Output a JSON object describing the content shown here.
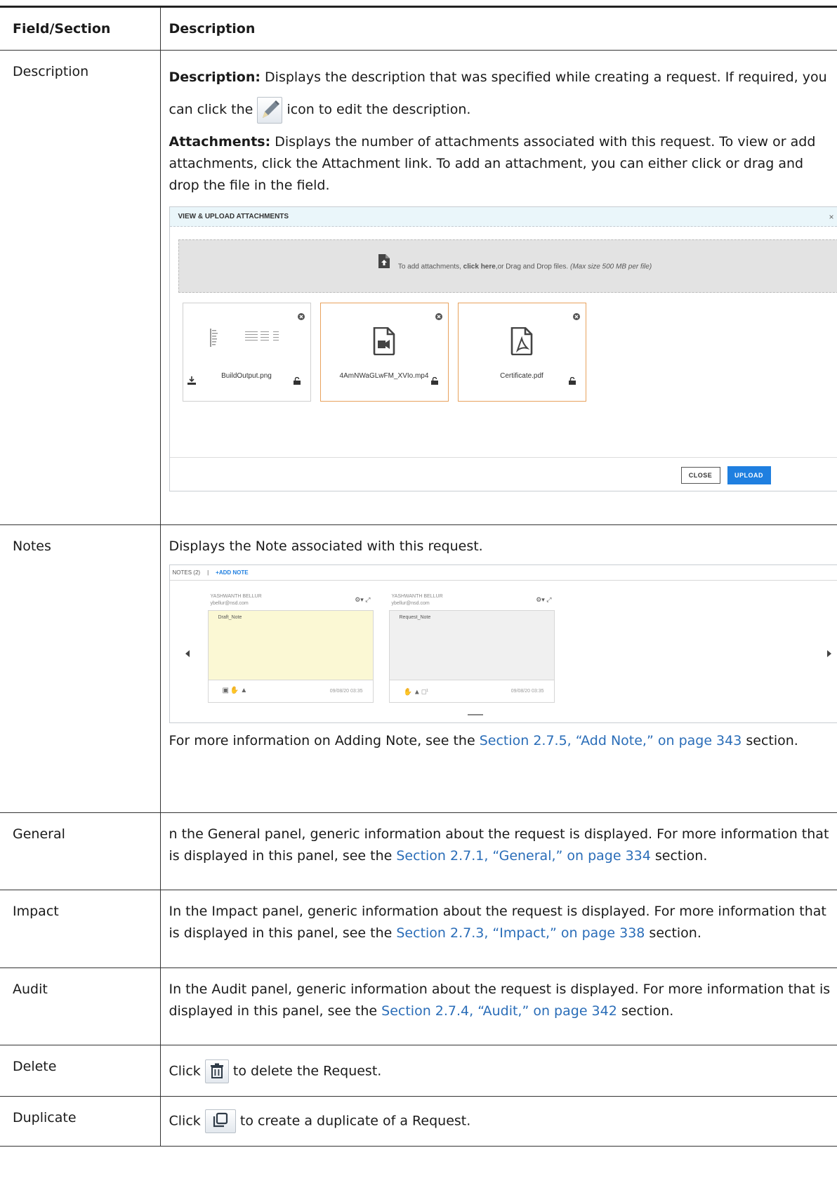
{
  "table": {
    "header": {
      "col1": "Field/Section",
      "col2": "Description"
    },
    "description_row": {
      "field": "Description",
      "p1_bold": "Description:",
      "p1_text": " Displays the description that was specified while creating a request. If required, you can click the",
      "p1_tail": "icon to edit the description.",
      "p2_bold": "Attachments:",
      "p2_text": " Displays the number of attachments associated with this request. To view or add attachments, click the Attachment link. To add an attachment, you can either click or drag and drop the file in the field."
    },
    "notes_row": {
      "field": "Notes",
      "intro": "Displays the Note associated with this request.",
      "more_before": "For more information on Adding Note, see the ",
      "more_link": "Section 2.7.5, “Add Note,” on page 343",
      "more_after": " section."
    },
    "general_row": {
      "field": "General",
      "text": "n the General panel, generic information about the request is displayed. For more information that is displayed in this panel, see the ",
      "link": "Section 2.7.1, “General,” on page 334",
      "after": " section."
    },
    "impact_row": {
      "field": "Impact",
      "text": "In the Impact panel, generic information about the request is displayed. For more information that is displayed in this panel, see the ",
      "link": "Section 2.7.3, “Impact,” on page 338",
      "after": " section."
    },
    "audit_row": {
      "field": "Audit",
      "text": "In the Audit panel, generic information about the request is displayed. For more information that is displayed in this panel, see the ",
      "link": "Section 2.7.4, “Audit,” on page 342",
      "after": " section."
    },
    "delete_row": {
      "field": "Delete",
      "before": "Click",
      "after": "to delete the Request."
    },
    "duplicate_row": {
      "field": "Duplicate",
      "before": "Click",
      "after": "to create a duplicate of a Request."
    }
  },
  "attachments_dialog": {
    "title": "VIEW & UPLOAD ATTACHMENTS",
    "close_x": "×",
    "drop_before": "To add attachments, ",
    "drop_link": "click here",
    "drop_after": ",or Drag and Drop files. ",
    "drop_note": "(Max size 500 MB per file)",
    "files": [
      {
        "name": "BuildOutput.png",
        "kind": "image-thumbnail"
      },
      {
        "name": "4AmNWaGLwFM_XVIo.mp4",
        "kind": "video-file-icon"
      },
      {
        "name": "Certificate.pdf",
        "kind": "pdf-file-icon"
      }
    ],
    "close_label": "CLOSE",
    "upload_label": "UPLOAD",
    "upload_color": "#1f7fe0",
    "selected_border_color": "#e8a25d"
  },
  "notes_panel": {
    "header_label": "NOTES (2)",
    "separator": "|",
    "add_label": "+ADD NOTE",
    "notes": [
      {
        "author": "YASHWANTH BELLUR",
        "email": "ybellur@nsd.com",
        "title": "Draft_Note",
        "timestamp": "09/08/20 03:35",
        "bg": "#fbf8d4"
      },
      {
        "author": "YASHWANTH BELLUR",
        "email": "ybellur@nsd.com",
        "title": "Request_Note",
        "timestamp": "09/08/20 03:35",
        "bg": "#f0f0f0",
        "comment_count": "1"
      }
    ]
  },
  "link_color": "#2a6db8"
}
